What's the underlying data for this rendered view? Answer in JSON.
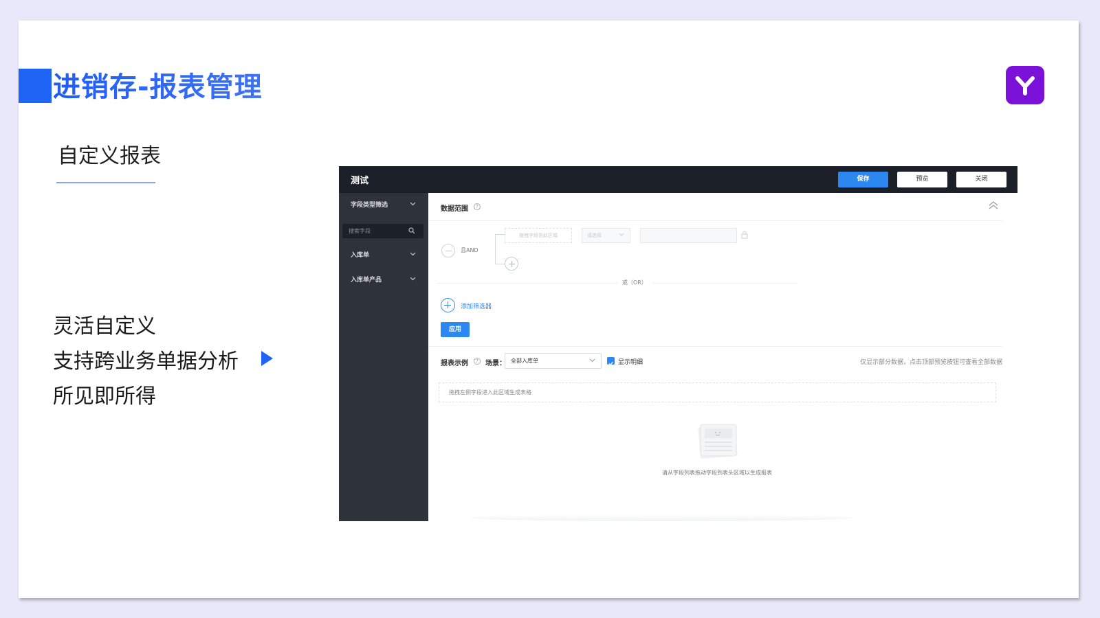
{
  "slide": {
    "title": "进销存-报表管理",
    "subtitle": "自定义报表",
    "features": [
      "灵活自定义",
      "支持跨业务单据分析",
      "所见即所得"
    ],
    "logo_icon": "y-logo-icon",
    "brand_color": "#1e64f5",
    "logo_color": "#7b11d8"
  },
  "app": {
    "title": "测试",
    "buttons": {
      "save": "保存",
      "preview": "预览",
      "close": "关闭"
    },
    "sidebar": {
      "filter_label": "字段类型筛选",
      "search_placeholder": "搜索字段",
      "groups": [
        "入库单",
        "入库单产品"
      ]
    },
    "data_range": {
      "label": "数据范围",
      "and_label": "且AND",
      "drop_placeholder": "拖拽字段到此区域",
      "select_placeholder": "请选择",
      "or_label": "或（OR）",
      "add_filter": "添加筛选器",
      "apply": "应用"
    },
    "report": {
      "label": "报表示例",
      "scene_label": "场景：",
      "scene_value": "全部入库单",
      "show_detail": "显示明细",
      "hint": "仅显示部分数据，点击顶部预览按钮可查看全部数据",
      "table_drop": "拖拽左侧字段进入此区域生成表格",
      "empty_text": "请从字段列表拖动字段到表头区域以生成报表"
    }
  }
}
